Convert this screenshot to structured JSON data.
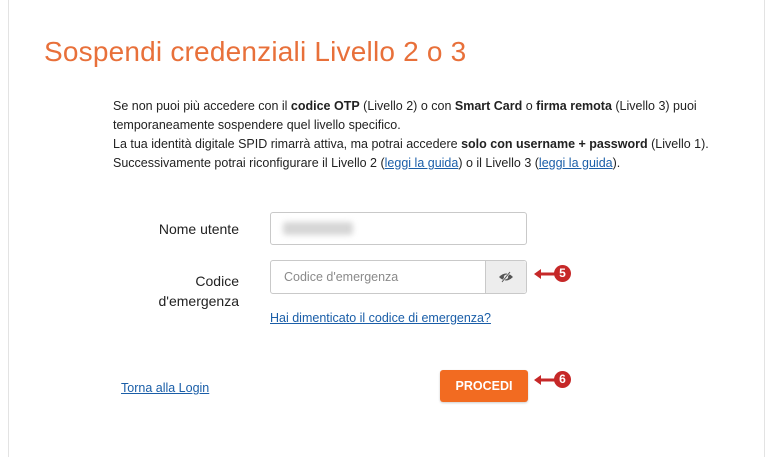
{
  "page": {
    "title": "Sospendi credenziali Livello 2 o 3"
  },
  "description": {
    "l1_a": "Se non puoi più accedere con il ",
    "l1_b": "codice OTP",
    "l1_c": " (Livello 2) o con ",
    "l1_d": "Smart Card",
    "l1_e": " o ",
    "l1_f": "firma remota",
    "l1_g": " (Livello 3) puoi",
    "l2": "temporaneamente sospendere quel livello specifico.",
    "l3_a": "La tua identità digitale SPID rimarrà attiva, ma potrai accedere ",
    "l3_b": "solo con username + password",
    "l3_c": " (Livello 1).",
    "l4_a": "Successivamente potrai riconfigurare il Livello 2 (",
    "l4_link1": "leggi la guida",
    "l4_b": ") o il Livello 3 (",
    "l4_link2": "leggi la guida",
    "l4_c": ")."
  },
  "form": {
    "username_label": "Nome utente",
    "code_label_1": "Codice",
    "code_label_2": "d'emergenza",
    "code_placeholder": "Codice d'emergenza",
    "forgot_link": "Hai dimenticato il codice di emergenza?",
    "back_link": "Torna alla Login",
    "submit_label": "PROCEDI"
  },
  "annotations": [
    {
      "number": "5"
    },
    {
      "number": "6"
    }
  ],
  "colors": {
    "title": "#e8703a",
    "button": "#f26b21",
    "link": "#1a5ea8",
    "annotation": "#c62828"
  },
  "icons": [
    "eye-hide-icon",
    "arrow-left-icon"
  ]
}
